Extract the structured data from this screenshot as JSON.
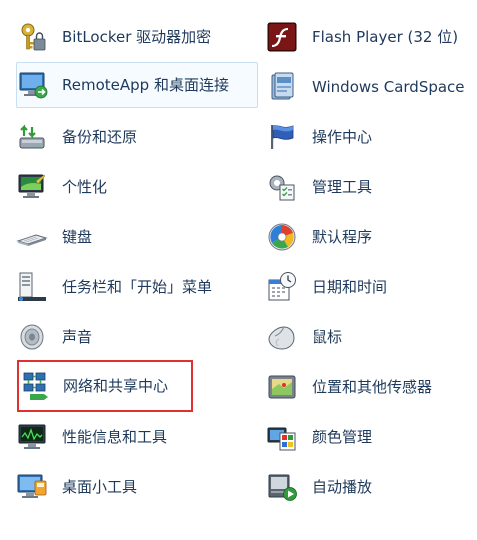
{
  "colors": {
    "label_text": "#1e395b",
    "hover_bg": "#f6fbff",
    "hover_border": "#c8def2",
    "highlight_border": "#e0312e"
  },
  "items_left": [
    {
      "label": "BitLocker 驱动器加密",
      "icon": "bitlocker-key-icon"
    },
    {
      "label": "RemoteApp 和桌面连接",
      "icon": "remoteapp-monitor-icon"
    },
    {
      "label": "备份和还原",
      "icon": "backup-restore-icon"
    },
    {
      "label": "个性化",
      "icon": "personalization-monitor-icon"
    },
    {
      "label": "键盘",
      "icon": "keyboard-icon"
    },
    {
      "label": "任务栏和「开始」菜单",
      "icon": "taskbar-start-menu-icon"
    },
    {
      "label": "声音",
      "icon": "speaker-icon"
    },
    {
      "label": "网络和共享中心",
      "icon": "network-sharing-icon"
    },
    {
      "label": "性能信息和工具",
      "icon": "performance-monitor-icon"
    },
    {
      "label": "桌面小工具",
      "icon": "desktop-gadgets-icon"
    }
  ],
  "items_right": [
    {
      "label": "Flash Player (32 位)",
      "icon": "flash-player-icon"
    },
    {
      "label": "Windows CardSpace",
      "icon": "cardspace-icon"
    },
    {
      "label": "操作中心",
      "icon": "action-center-flag-icon"
    },
    {
      "label": "管理工具",
      "icon": "admin-tools-icon"
    },
    {
      "label": "默认程序",
      "icon": "default-programs-icon"
    },
    {
      "label": "日期和时间",
      "icon": "date-time-icon"
    },
    {
      "label": "鼠标",
      "icon": "mouse-icon"
    },
    {
      "label": "位置和其他传感器",
      "icon": "location-sensors-icon"
    },
    {
      "label": "颜色管理",
      "icon": "color-management-icon"
    },
    {
      "label": "自动播放",
      "icon": "autoplay-icon"
    }
  ]
}
